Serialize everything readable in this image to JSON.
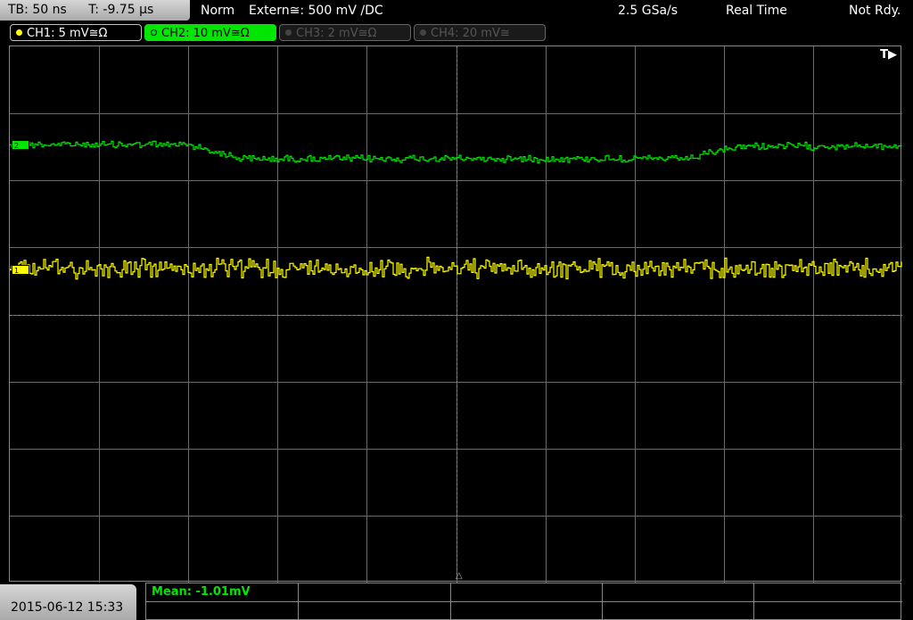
{
  "status": {
    "timebase": "TB: 50 ns",
    "trigger_time": "T: -9.75 µs",
    "trigger_mode": "Norm",
    "trigger_source": "Extern≅: 500 mV ∕DC",
    "sample_rate": "2.5 GSa/s",
    "acq_mode": "Real Time",
    "trigger_state": "Not Rdy."
  },
  "channels": [
    {
      "label": "CH1: 5 mV≅Ω",
      "color": "#ffff00",
      "active": true
    },
    {
      "label": "CH2: 10 mV≅Ω",
      "color": "#00e600",
      "active": true,
      "selected": true
    },
    {
      "label": "CH3: 2 mV≅Ω",
      "color": "#555555",
      "active": false
    },
    {
      "label": "CH4: 20 mV≅",
      "color": "#555555",
      "active": false
    }
  ],
  "screen": {
    "trigger_indicator": "T▶",
    "marker_ch1": "1",
    "marker_ch2": "2",
    "trigger_position_icon": "△"
  },
  "footer": {
    "datetime": "2015-06-12 15:33",
    "measurement": "Mean: -1.01mV"
  },
  "colors": {
    "ch1": "#ffff00",
    "ch2": "#00e600",
    "grid": "#6a6a6a"
  }
}
